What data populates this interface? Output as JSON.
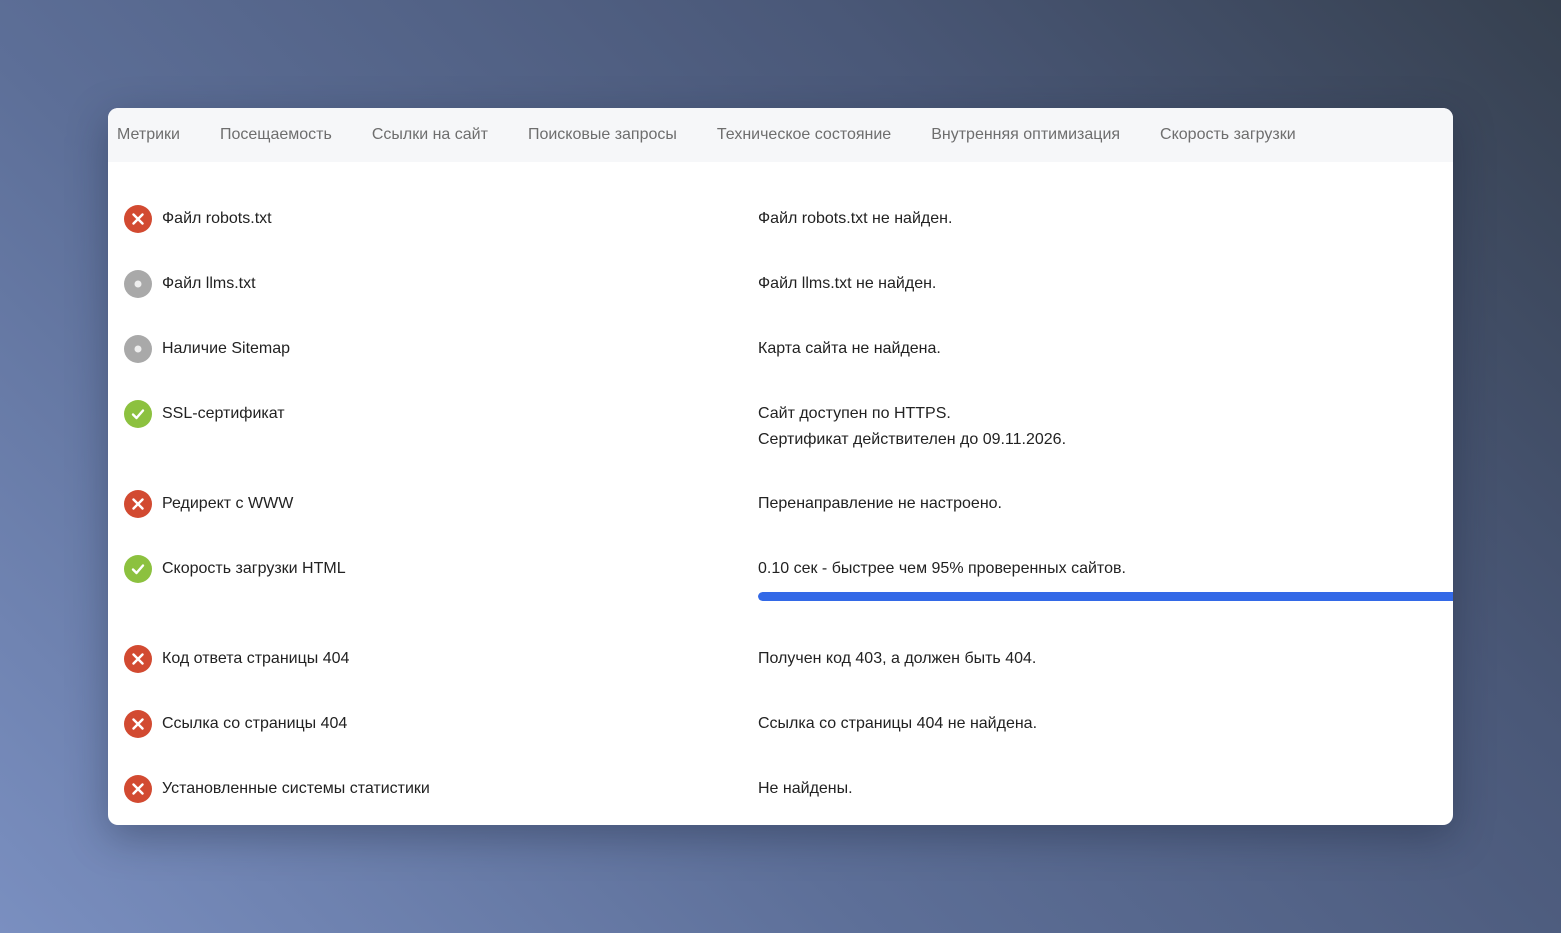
{
  "tabs": [
    {
      "label": "Метрики"
    },
    {
      "label": "Посещаемость"
    },
    {
      "label": "Ссылки на сайт"
    },
    {
      "label": "Поисковые запросы"
    },
    {
      "label": "Техническое состояние"
    },
    {
      "label": "Внутренняя оптимизация"
    },
    {
      "label": "Скорость загрузки"
    }
  ],
  "colors": {
    "error": "#d24a31",
    "ok": "#8cc13f",
    "neutral": "#a9a9a9",
    "progress": "#3369e7"
  },
  "checks": [
    {
      "status": "error",
      "icon": "cross-icon",
      "label": "Файл robots.txt",
      "lines": [
        "Файл robots.txt не найден."
      ]
    },
    {
      "status": "neutral",
      "icon": "dot-icon",
      "label": "Файл llms.txt",
      "lines": [
        "Файл llms.txt не найден."
      ]
    },
    {
      "status": "neutral",
      "icon": "dot-icon",
      "label": "Наличие Sitemap",
      "lines": [
        "Карта сайта не найдена."
      ]
    },
    {
      "status": "ok",
      "icon": "checkmark-icon",
      "label": "SSL-сертификат",
      "lines": [
        "Сайт доступен по HTTPS.",
        "Сертификат действителен до 09.11.2026."
      ]
    },
    {
      "status": "error",
      "icon": "cross-icon",
      "label": "Редирект с WWW",
      "lines": [
        "Перенаправление не настроено."
      ]
    },
    {
      "status": "ok",
      "icon": "checkmark-icon",
      "label": "Скорость загрузки HTML",
      "lines": [
        "0.10 сек - быстрее чем 95% проверенных сайтов."
      ],
      "progress_percent": 95
    },
    {
      "status": "error",
      "icon": "cross-icon",
      "label": "Код ответа страницы 404",
      "lines": [
        "Получен код 403, а должен быть 404."
      ]
    },
    {
      "status": "error",
      "icon": "cross-icon",
      "label": "Ссылка со страницы 404",
      "lines": [
        "Ссылка со страницы 404 не найдена."
      ]
    },
    {
      "status": "error",
      "icon": "cross-icon",
      "label": "Установленные системы статистики",
      "lines": [
        "Не найдены."
      ]
    }
  ]
}
